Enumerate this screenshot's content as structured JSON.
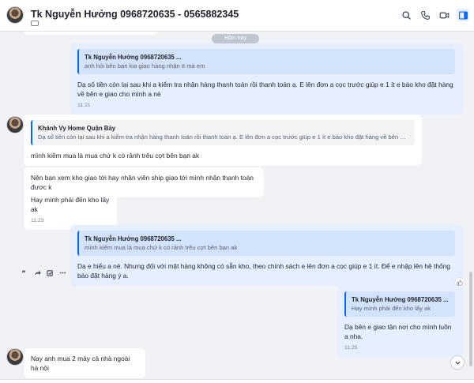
{
  "header": {
    "title": "Tk Nguyễn Hưởng 0968720635 - 0565882345",
    "icons": [
      "search-icon",
      "phone-icon",
      "video-call-icon",
      "conversation-info-icon"
    ]
  },
  "chat": {
    "date_separator": "Hôm nay",
    "messages": [
      {
        "quote_name": "Tk Nguyễn Hưởng 0968720635 ...",
        "quote_text": "anh hỏi bên bạn kia giao hàng nhận tt mà em",
        "text": "Dạ số tiền còn lại sau khi a kiểm tra nhận hàng thanh toán rồi thanh toán ạ. E lên đơn a cọc trước giúp e 1 ít e báo kho đặt hàng về bên e giao cho mình a nè",
        "time": "11:21"
      },
      {
        "quote_name": "Khánh Vy Home Quận Bảy",
        "quote_text": "Dạ số tiền còn lại sau khi a kiểm tra nhận hàng thanh toán rồi thanh toán ạ. E lên đơn a cọc trước giúp e 1 ít e báo kho đặt hàng về bên e giao ch...",
        "text": "mình kiếm mua là mua chứ k có rảnh trêu cợt bên bạn ak"
      },
      {
        "text": "Nên bạn xem kho giao tới hay nhân viên ship giao tới mình nhận thanh toán được k"
      },
      {
        "text": "Hay mình phải đến kho lấy ak",
        "time": "11:23"
      },
      {
        "quote_name": "Tk Nguyễn Hưởng 0968720635 ...",
        "quote_text": "mình kiếm mua là mua chứ k có rảnh trêu cợt bên bạn ak",
        "text": "Dạ e hiểu a nè. Nhưng đối với mặt hàng không có sẵn kho, theo chính sách e lên đơn a cọc giúp e 1 ít.  Để e nhập lên hệ thống báo đặt hàng ý a."
      },
      {
        "quote_name": "Tk Nguyễn Hưởng 0968720635 ...",
        "quote_text": "Hay mình phải đến kho lấy ak",
        "text": "Dạ bên e giao tận nơi cho mình luôn a nha.",
        "time": "11:25"
      },
      {
        "text": "Nay anh mua 2 máy cả nhà ngoài hà nội"
      }
    ]
  }
}
